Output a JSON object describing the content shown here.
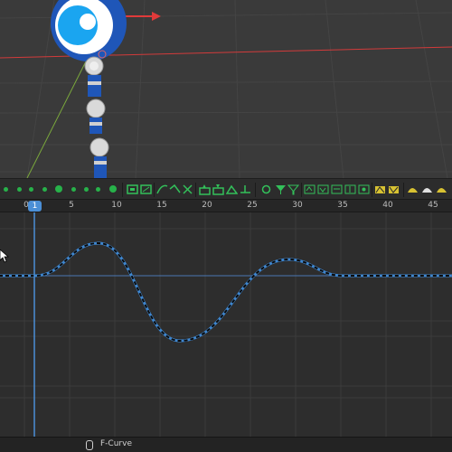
{
  "timeline": {
    "ruler_labels": [
      "0",
      "5",
      "10",
      "15",
      "20",
      "25",
      "30",
      "35",
      "40",
      "45"
    ],
    "current_frame": "1"
  },
  "graph_editor": {
    "curve_keyframes": [
      {
        "frame": 1,
        "value": 0
      },
      {
        "frame": 8,
        "value": 0.36
      },
      {
        "frame": 17,
        "value": -0.72
      },
      {
        "frame": 29,
        "value": 0.18
      },
      {
        "frame": 35,
        "value": 0
      },
      {
        "frame": 46,
        "value": 0
      }
    ]
  },
  "status_bar": {
    "mode_label": "F-Curve"
  },
  "colors": {
    "curve": "#3e86cf",
    "playhead": "#4b8fd6",
    "keyframe_dot": "#27b24a",
    "x_axis": "#d23a3a",
    "y_axis": "#7aa83c"
  },
  "icons": {
    "toolbar": [
      "keyframe-dot-icon",
      "keyframe-insert-icon",
      "interpolation-icon",
      "clear-keys-icon",
      "copy-keys-icon",
      "paste-keys-icon",
      "snap-icon",
      "filter-icon",
      "key-type-icon",
      "ease-icon"
    ],
    "cursor": "mouse-pointer-icon",
    "status": "mouse-button-icon"
  }
}
